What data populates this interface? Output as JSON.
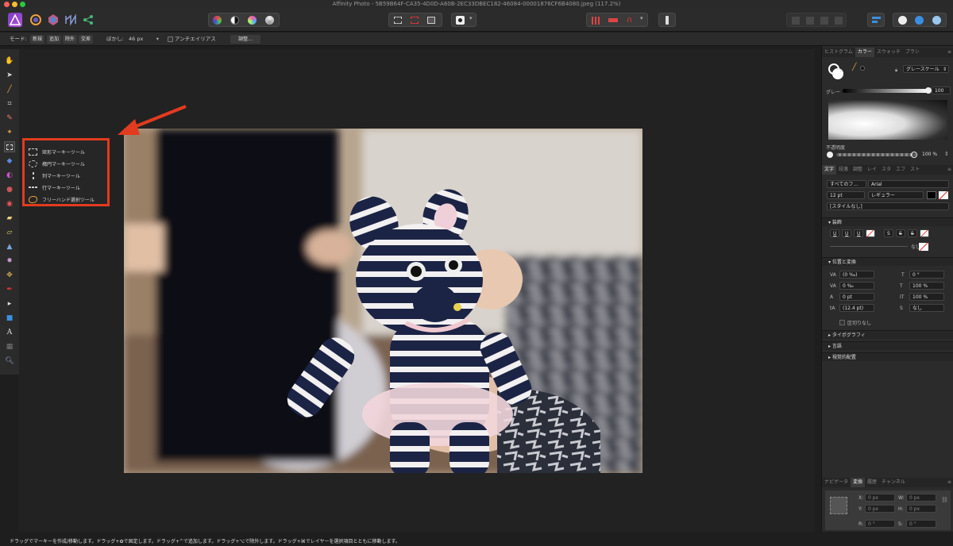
{
  "window": {
    "title": "Affinity Photo - 5B59B64F-CA35-4D0D-A60B-2EC33DBEC182-46084-00001876CF6B4080.jpeg (117.2%)"
  },
  "context_bar": {
    "mode_label": "モード:",
    "modes": [
      "新規",
      "追加",
      "除外",
      "交差"
    ],
    "feather_label": "ぼかし:",
    "feather_value": "46 px",
    "antialias_label": "アンチエイリアス",
    "adjust_button": "調整..."
  },
  "marquee_flyout": {
    "items": [
      "矩形マーキーツール",
      "楕円マーキーツール",
      "列マーキーツール",
      "行マーキーツール",
      "フリーハンド選択ツール"
    ]
  },
  "right_panel": {
    "top_tabs": [
      "ヒストグラム",
      "カラー",
      "スウォッチ",
      "ブラシ"
    ],
    "color_mode": "グレースケール",
    "gray_label": "グレー",
    "gray_value": "100",
    "opacity_label": "不透明度",
    "opacity_value": "100 %",
    "text_tabs": [
      "文字",
      "段落",
      "調整",
      "レイ",
      "スタ",
      "エフ",
      "スト"
    ],
    "font_collection": "すべてのフ…",
    "font_family": "Arial",
    "font_size": "12 pt",
    "font_style": "レギュラー",
    "style_none": "[スタイルなし]",
    "decoration_title": "装飾",
    "decoration_none": "なし",
    "position_title": "位置と変換",
    "tracking": "(0 ‰)",
    "kerning": "0 ‰",
    "baseline": "0 pt",
    "leading": "(12.4 pt)",
    "skew": "0 °",
    "hscale": "100 %",
    "vscale": "100 %",
    "shear_none": "なし",
    "no_break": "区切りなし",
    "typography_title": "タイポグラフィ",
    "language_title": "言語",
    "visual_title": "視覚的配置",
    "bottom_tabs": [
      "ナビゲータ",
      "変換",
      "履歴",
      "チャンネル"
    ],
    "transform": {
      "x_label": "X:",
      "x": "0 px",
      "y_label": "Y:",
      "y": "0 px",
      "w_label": "W:",
      "w": "0 px",
      "h_label": "H:",
      "h": "0 px",
      "r_label": "R:",
      "r": "0 °",
      "s_label": "S:",
      "s": "0 °"
    }
  },
  "status_bar": {
    "text": "ドラッグでマーキーを作成/移動します。ドラッグ+✿で固定します。ドラッグ+^で追加します。ドラッグ+⌥で除外します。ドラッグ+⌘でレイヤーを選択項目とともに移動します。"
  },
  "colors": {
    "accent": "#e23b1f",
    "bg": "#1e1e1e",
    "panel": "#2b2b2b"
  }
}
